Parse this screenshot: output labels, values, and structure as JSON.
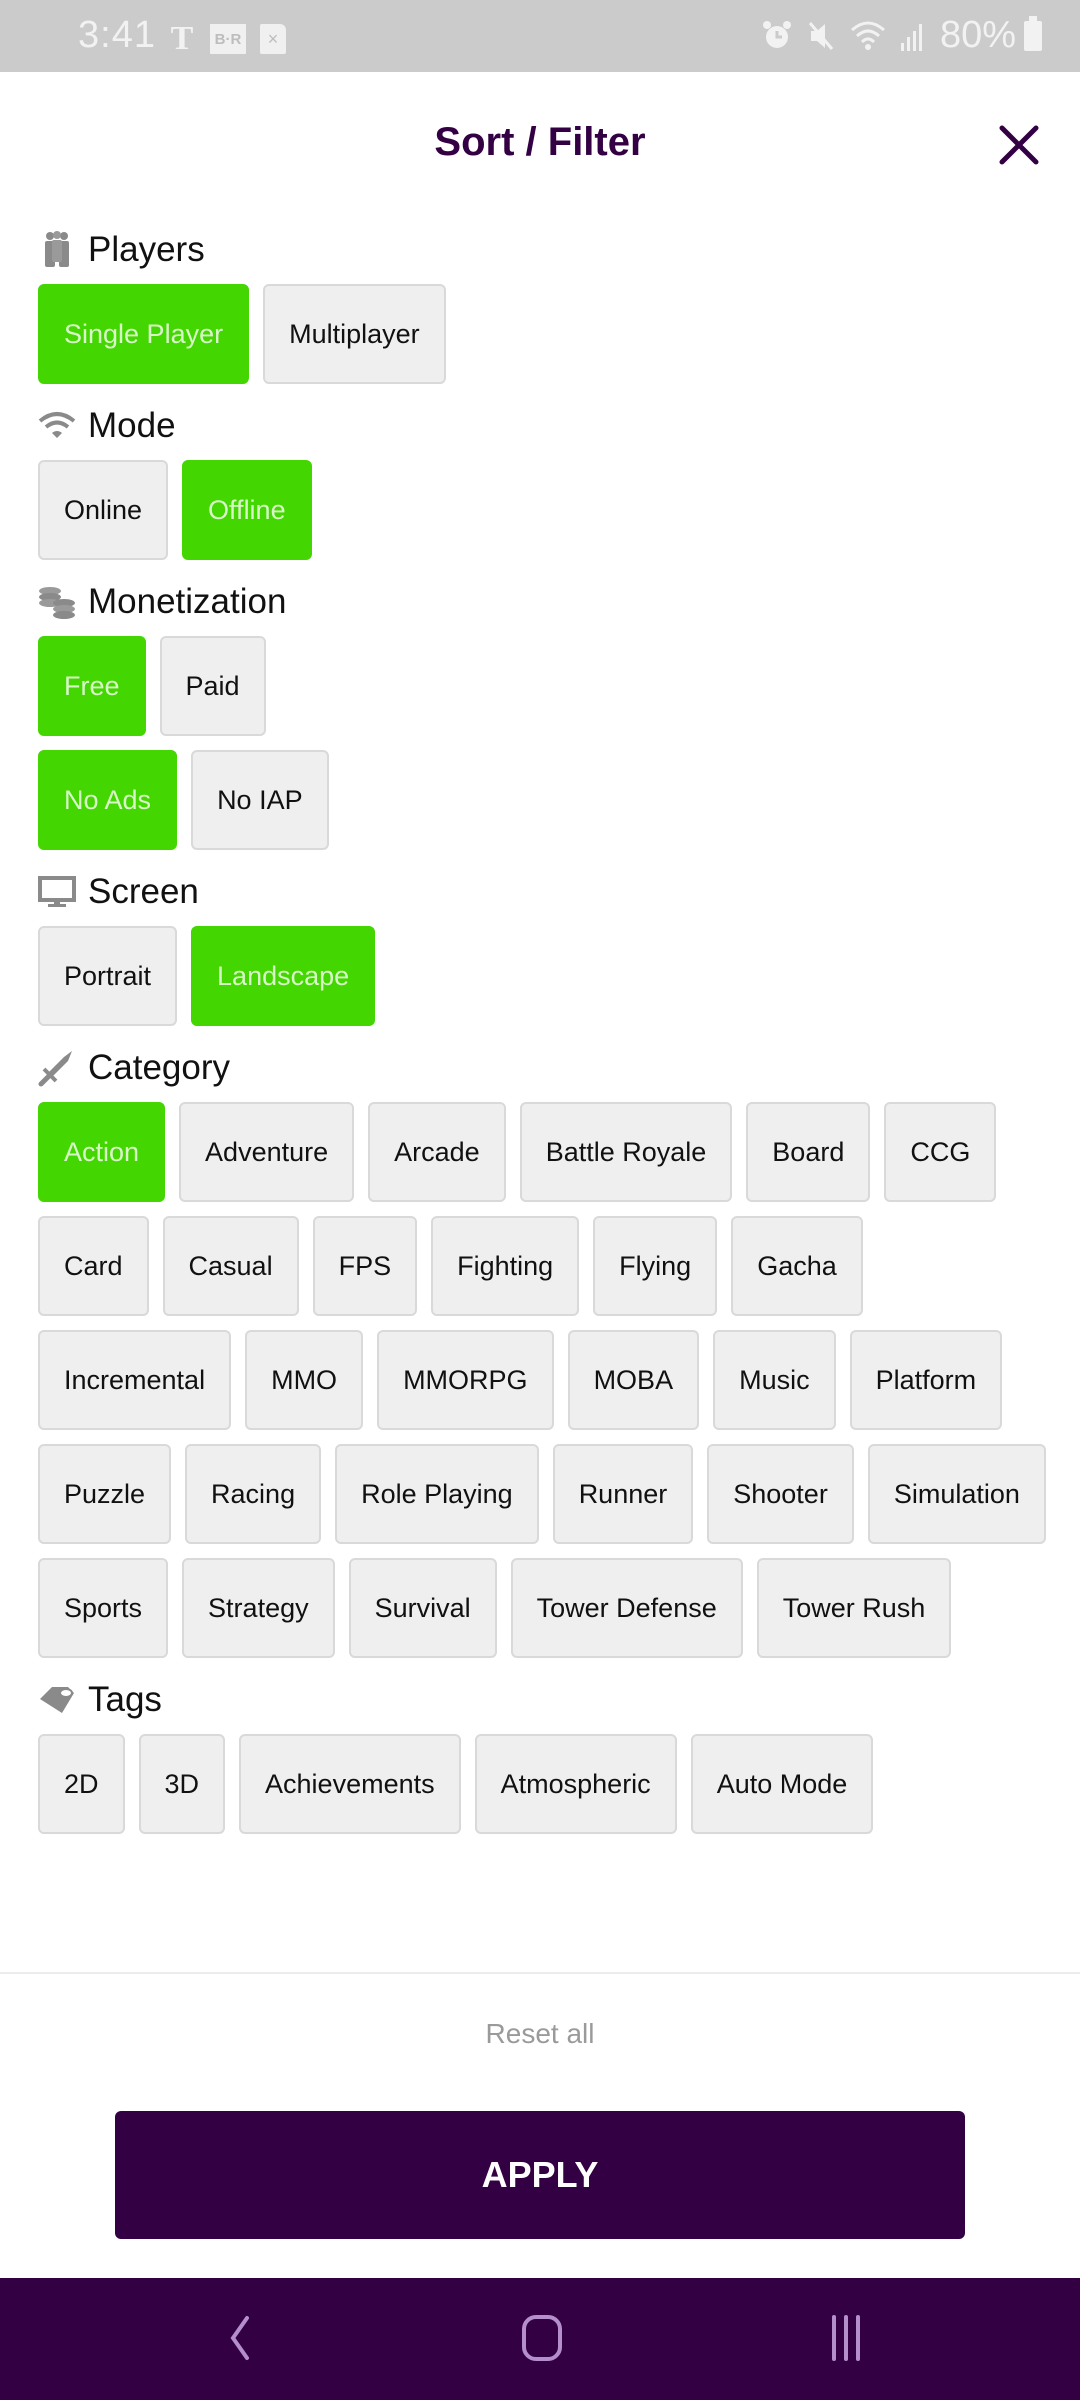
{
  "status_bar": {
    "time": "3:41",
    "left_icons": [
      "nyt-icon",
      "bleacher-report-icon",
      "file-x-icon"
    ],
    "br_label": "B·R",
    "file_label": "×",
    "nyt_label": "T",
    "right_icons": [
      "alarm-icon",
      "mute-icon",
      "wifi-icon",
      "signal-icon"
    ],
    "battery": "80%"
  },
  "header": {
    "title": "Sort / Filter",
    "close_icon": "close-icon"
  },
  "colors": {
    "brand": "#330044",
    "selected": "#44d600",
    "chip_bg": "#efefef",
    "status_bar": "#cbcbcb"
  },
  "sections": {
    "players": {
      "title": "Players",
      "icon": "players-icon",
      "options": [
        {
          "label": "Single Player",
          "selected": true
        },
        {
          "label": "Multiplayer",
          "selected": false
        }
      ]
    },
    "mode": {
      "title": "Mode",
      "icon": "wifi-icon",
      "options": [
        {
          "label": "Online",
          "selected": false
        },
        {
          "label": "Offline",
          "selected": true
        }
      ]
    },
    "monetization": {
      "title": "Monetization",
      "icon": "coins-icon",
      "rows": [
        [
          {
            "label": "Free",
            "selected": true
          },
          {
            "label": "Paid",
            "selected": false
          }
        ],
        [
          {
            "label": "No Ads",
            "selected": true
          },
          {
            "label": "No IAP",
            "selected": false
          }
        ]
      ]
    },
    "screen": {
      "title": "Screen",
      "icon": "monitor-icon",
      "options": [
        {
          "label": "Portrait",
          "selected": false
        },
        {
          "label": "Landscape",
          "selected": true
        }
      ]
    },
    "category": {
      "title": "Category",
      "icon": "sword-icon",
      "options": [
        {
          "label": "Action",
          "selected": true
        },
        {
          "label": "Adventure",
          "selected": false
        },
        {
          "label": "Arcade",
          "selected": false
        },
        {
          "label": "Battle Royale",
          "selected": false
        },
        {
          "label": "Board",
          "selected": false
        },
        {
          "label": "CCG",
          "selected": false
        },
        {
          "label": "Card",
          "selected": false
        },
        {
          "label": "Casual",
          "selected": false
        },
        {
          "label": "FPS",
          "selected": false
        },
        {
          "label": "Fighting",
          "selected": false
        },
        {
          "label": "Flying",
          "selected": false
        },
        {
          "label": "Gacha",
          "selected": false
        },
        {
          "label": "Incremental",
          "selected": false
        },
        {
          "label": "MMO",
          "selected": false
        },
        {
          "label": "MMORPG",
          "selected": false
        },
        {
          "label": "MOBA",
          "selected": false
        },
        {
          "label": "Music",
          "selected": false
        },
        {
          "label": "Platform",
          "selected": false
        },
        {
          "label": "Puzzle",
          "selected": false
        },
        {
          "label": "Racing",
          "selected": false
        },
        {
          "label": "Role Playing",
          "selected": false
        },
        {
          "label": "Runner",
          "selected": false
        },
        {
          "label": "Shooter",
          "selected": false
        },
        {
          "label": "Simulation",
          "selected": false
        },
        {
          "label": "Sports",
          "selected": false
        },
        {
          "label": "Strategy",
          "selected": false
        },
        {
          "label": "Survival",
          "selected": false
        },
        {
          "label": "Tower Defense",
          "selected": false
        },
        {
          "label": "Tower Rush",
          "selected": false
        }
      ]
    },
    "tags": {
      "title": "Tags",
      "icon": "tag-icon",
      "options": [
        {
          "label": "2D",
          "selected": false
        },
        {
          "label": "3D",
          "selected": false
        },
        {
          "label": "Achievements",
          "selected": false
        },
        {
          "label": "Atmospheric",
          "selected": false
        },
        {
          "label": "Auto Mode",
          "selected": false
        }
      ]
    }
  },
  "footer": {
    "reset_label": "Reset all",
    "apply_label": "APPLY"
  },
  "nav_bar": {
    "buttons": [
      "back-icon",
      "home-icon",
      "recents-icon"
    ]
  }
}
